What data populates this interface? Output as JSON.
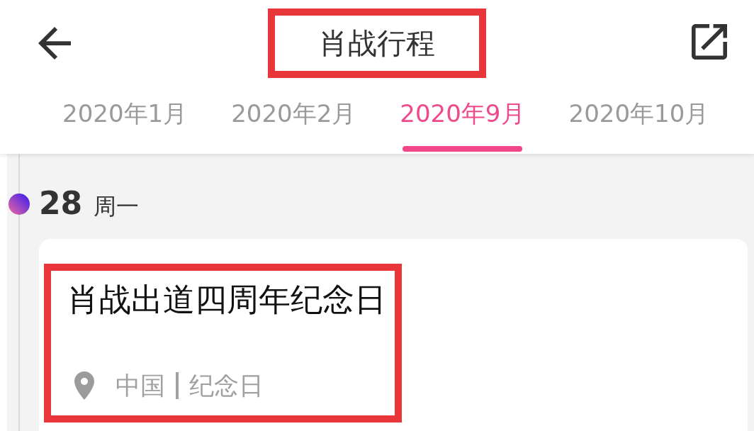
{
  "header": {
    "title": "肖战行程",
    "highlighted": true
  },
  "tabs": [
    {
      "label": "2020年1月",
      "selected": false
    },
    {
      "label": "2020年2月",
      "selected": false
    },
    {
      "label": "2020年9月",
      "selected": true
    },
    {
      "label": "2020年10月",
      "selected": false
    }
  ],
  "timeline": [
    {
      "day": "28",
      "weekday": "周一",
      "events": [
        {
          "title": "肖战出道四周年纪念日",
          "location": "中国",
          "category": "纪念日",
          "highlighted": true
        }
      ]
    }
  ]
}
